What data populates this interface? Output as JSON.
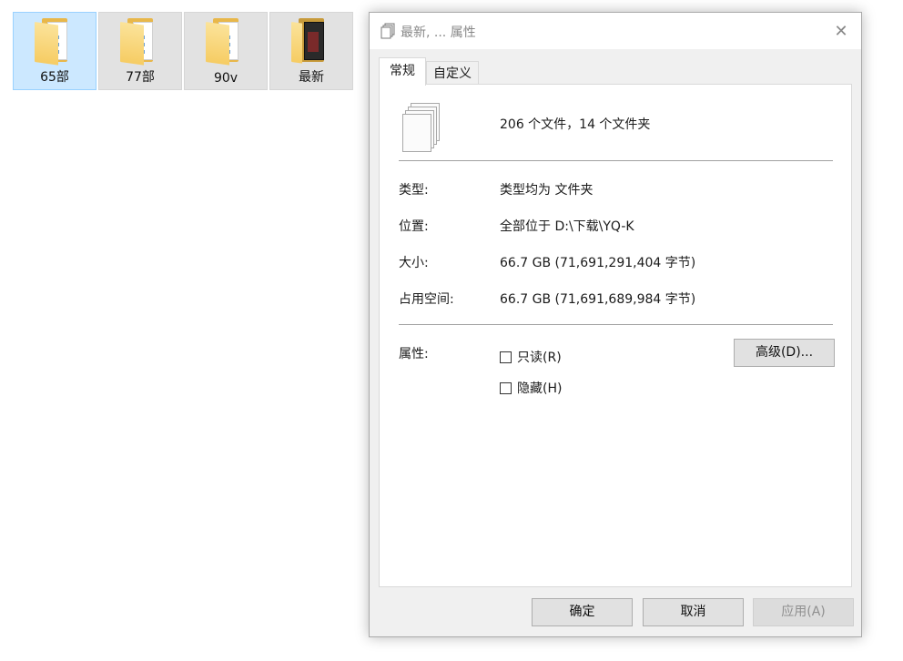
{
  "explorer": {
    "folders": [
      {
        "label": "65部",
        "selected": true
      },
      {
        "label": "77部",
        "selected": false
      },
      {
        "label": "90v",
        "selected": false
      },
      {
        "label": "最新",
        "selected": false
      }
    ]
  },
  "dialog": {
    "title": "最新, ... 属性",
    "close_glyph": "✕",
    "tabs": [
      {
        "label": "常规",
        "active": true
      },
      {
        "label": "自定义",
        "active": false
      }
    ],
    "summary": "206 个文件，14 个文件夹",
    "fields": {
      "type": {
        "label": "类型:",
        "value": "类型均为 文件夹"
      },
      "location": {
        "label": "位置:",
        "value": "全部位于 D:\\下载\\YQ-K"
      },
      "size": {
        "label": "大小:",
        "value": "66.7 GB (71,691,291,404 字节)"
      },
      "size_on_disk": {
        "label": "占用空间:",
        "value": "66.7 GB (71,691,689,984 字节)"
      }
    },
    "attributes": {
      "label": "属性:",
      "readonly": {
        "label": "只读(R)",
        "checked": false
      },
      "hidden": {
        "label": "隐藏(H)",
        "checked": false
      },
      "advanced_button": "高级(D)..."
    },
    "buttons": {
      "ok": "确定",
      "cancel": "取消",
      "apply": "应用(A)"
    }
  },
  "colors": {
    "selection_bg": "#cce8ff",
    "dialog_bg": "#f0f0f0",
    "button_bg": "#e1e1e1"
  }
}
